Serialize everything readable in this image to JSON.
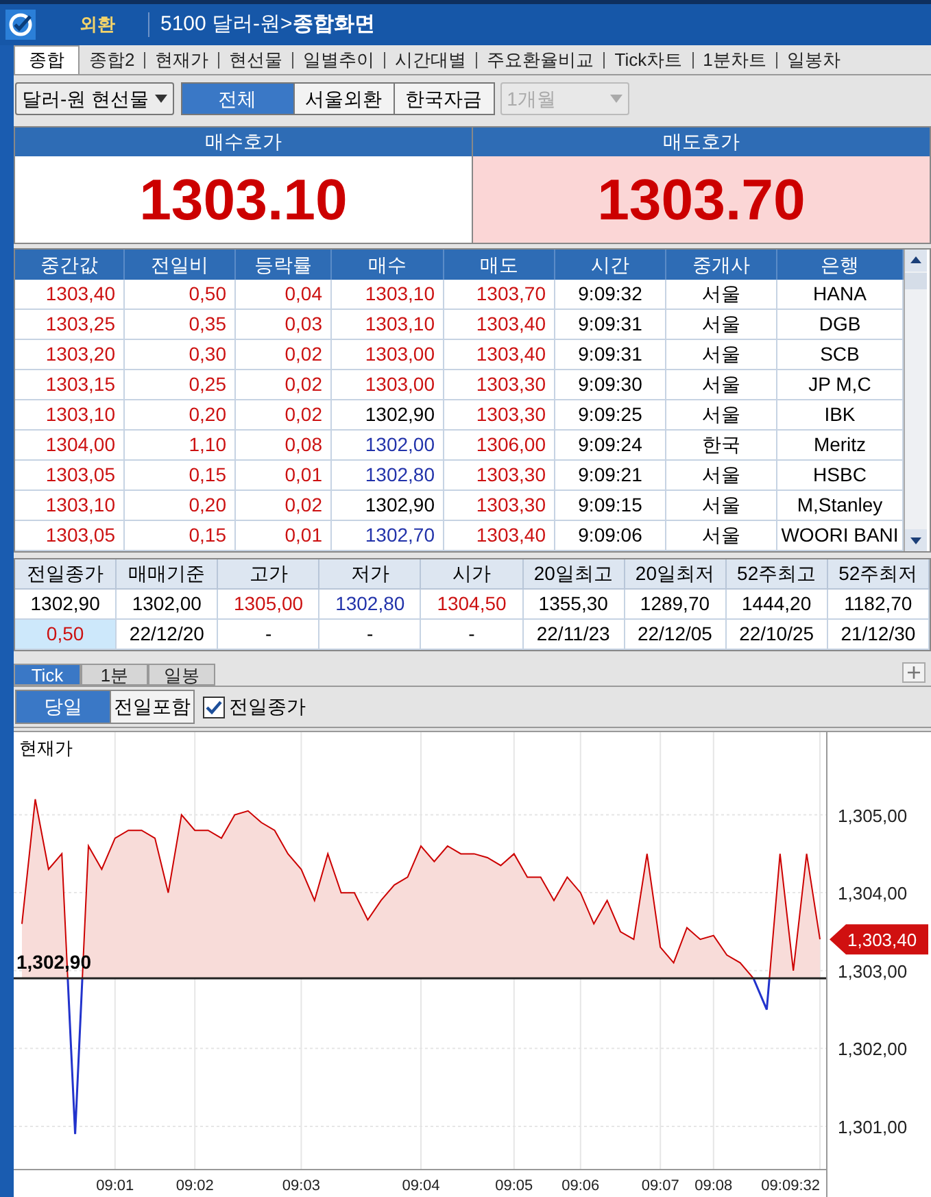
{
  "title_bar": {
    "badge": "외환",
    "title": "5100 달러-원>**종합화면**"
  },
  "tabs": [
    {
      "label": "종합",
      "selected": true
    },
    {
      "label": "종합2",
      "selected": false
    },
    {
      "label": "현재가",
      "selected": false
    },
    {
      "label": "현선물",
      "selected": false
    },
    {
      "label": "일별추이",
      "selected": false
    },
    {
      "label": "시간대별",
      "selected": false
    },
    {
      "label": "주요환율비교",
      "selected": false
    },
    {
      "label": "Tick차트",
      "selected": false
    },
    {
      "label": "1분차트",
      "selected": false
    },
    {
      "label": "일봉차",
      "selected": false
    }
  ],
  "toolbar": {
    "market": {
      "value": "달러-원 현선물"
    },
    "filters": [
      {
        "label": "전체",
        "selected": true
      },
      {
        "label": "서울외환",
        "selected": false
      },
      {
        "label": "한국자금",
        "selected": false
      }
    ],
    "period": {
      "value": "1개월",
      "disabled": true
    }
  },
  "quotes": [
    {
      "kind": "bid",
      "label": "매수호가",
      "price": "1303.10"
    },
    {
      "kind": "ask",
      "label": "매도호가",
      "price": "1303.70"
    }
  ],
  "trades": {
    "columns": [
      "중간값",
      "전일비",
      "등락률",
      "매수",
      "매도",
      "시간",
      "중개사",
      "은행"
    ],
    "rows": [
      [
        {
          "text": "1303,40",
          "color": "#cc1111"
        },
        {
          "text": "0,50",
          "color": "#cc1111"
        },
        {
          "text": "0,04",
          "color": "#cc1111"
        },
        {
          "text": "1303,10",
          "color": "#cc1111"
        },
        {
          "text": "1303,70",
          "color": "#cc1111"
        },
        {
          "text": "9:09:32",
          "color": "#000000"
        },
        {
          "text": "서울",
          "color": "#000000"
        },
        {
          "text": "HANA",
          "color": "#000000"
        }
      ],
      [
        {
          "text": "1303,25",
          "color": "#cc1111"
        },
        {
          "text": "0,35",
          "color": "#cc1111"
        },
        {
          "text": "0,03",
          "color": "#cc1111"
        },
        {
          "text": "1303,10",
          "color": "#cc1111"
        },
        {
          "text": "1303,40",
          "color": "#cc1111"
        },
        {
          "text": "9:09:31",
          "color": "#000000"
        },
        {
          "text": "서울",
          "color": "#000000"
        },
        {
          "text": "DGB",
          "color": "#000000"
        }
      ],
      [
        {
          "text": "1303,20",
          "color": "#cc1111"
        },
        {
          "text": "0,30",
          "color": "#cc1111"
        },
        {
          "text": "0,02",
          "color": "#cc1111"
        },
        {
          "text": "1303,00",
          "color": "#cc1111"
        },
        {
          "text": "1303,40",
          "color": "#cc1111"
        },
        {
          "text": "9:09:31",
          "color": "#000000"
        },
        {
          "text": "서울",
          "color": "#000000"
        },
        {
          "text": "SCB",
          "color": "#000000"
        }
      ],
      [
        {
          "text": "1303,15",
          "color": "#cc1111"
        },
        {
          "text": "0,25",
          "color": "#cc1111"
        },
        {
          "text": "0,02",
          "color": "#cc1111"
        },
        {
          "text": "1303,00",
          "color": "#cc1111"
        },
        {
          "text": "1303,30",
          "color": "#cc1111"
        },
        {
          "text": "9:09:30",
          "color": "#000000"
        },
        {
          "text": "서울",
          "color": "#000000"
        },
        {
          "text": "JP M,C",
          "color": "#000000"
        }
      ],
      [
        {
          "text": "1303,10",
          "color": "#cc1111"
        },
        {
          "text": "0,20",
          "color": "#cc1111"
        },
        {
          "text": "0,02",
          "color": "#cc1111"
        },
        {
          "text": "1302,90",
          "color": "#000000"
        },
        {
          "text": "1303,30",
          "color": "#cc1111"
        },
        {
          "text": "9:09:25",
          "color": "#000000"
        },
        {
          "text": "서울",
          "color": "#000000"
        },
        {
          "text": "IBK",
          "color": "#000000"
        }
      ],
      [
        {
          "text": "1304,00",
          "color": "#cc1111"
        },
        {
          "text": "1,10",
          "color": "#cc1111"
        },
        {
          "text": "0,08",
          "color": "#cc1111"
        },
        {
          "text": "1302,00",
          "color": "#2233aa"
        },
        {
          "text": "1306,00",
          "color": "#cc1111"
        },
        {
          "text": "9:09:24",
          "color": "#000000"
        },
        {
          "text": "한국",
          "color": "#000000"
        },
        {
          "text": "Meritz",
          "color": "#000000"
        }
      ],
      [
        {
          "text": "1303,05",
          "color": "#cc1111"
        },
        {
          "text": "0,15",
          "color": "#cc1111"
        },
        {
          "text": "0,01",
          "color": "#cc1111"
        },
        {
          "text": "1302,80",
          "color": "#2233aa"
        },
        {
          "text": "1303,30",
          "color": "#cc1111"
        },
        {
          "text": "9:09:21",
          "color": "#000000"
        },
        {
          "text": "서울",
          "color": "#000000"
        },
        {
          "text": "HSBC",
          "color": "#000000"
        }
      ],
      [
        {
          "text": "1303,10",
          "color": "#cc1111"
        },
        {
          "text": "0,20",
          "color": "#cc1111"
        },
        {
          "text": "0,02",
          "color": "#cc1111"
        },
        {
          "text": "1302,90",
          "color": "#000000"
        },
        {
          "text": "1303,30",
          "color": "#cc1111"
        },
        {
          "text": "9:09:15",
          "color": "#000000"
        },
        {
          "text": "서울",
          "color": "#000000"
        },
        {
          "text": "M,Stanley",
          "color": "#000000"
        }
      ],
      [
        {
          "text": "1303,05",
          "color": "#cc1111"
        },
        {
          "text": "0,15",
          "color": "#cc1111"
        },
        {
          "text": "0,01",
          "color": "#cc1111"
        },
        {
          "text": "1302,70",
          "color": "#2233aa"
        },
        {
          "text": "1303,40",
          "color": "#cc1111"
        },
        {
          "text": "9:09:06",
          "color": "#000000"
        },
        {
          "text": "서울",
          "color": "#000000"
        },
        {
          "text": "WOORI BANI",
          "color": "#000000"
        }
      ]
    ]
  },
  "summary": {
    "columns": [
      "전일종가",
      "매매기준",
      "고가",
      "저가",
      "시가",
      "20일최고",
      "20일최저",
      "52주최고",
      "52주최저"
    ],
    "rows": [
      [
        {
          "text": "1302,90",
          "color": "#000000",
          "highlighted": false
        },
        {
          "text": "1302,00",
          "color": "#000000",
          "highlighted": false
        },
        {
          "text": "1305,00",
          "color": "#cc1111",
          "highlighted": false
        },
        {
          "text": "1302,80",
          "color": "#2233aa",
          "highlighted": false
        },
        {
          "text": "1304,50",
          "color": "#cc1111",
          "highlighted": false
        },
        {
          "text": "1355,30",
          "color": "#000000",
          "highlighted": false
        },
        {
          "text": "1289,70",
          "color": "#000000",
          "highlighted": false
        },
        {
          "text": "1444,20",
          "color": "#000000",
          "highlighted": false
        },
        {
          "text": "1182,70",
          "color": "#000000",
          "highlighted": false
        }
      ],
      [
        {
          "text": "0,50",
          "color": "#cc1111",
          "highlighted": true
        },
        {
          "text": "22/12/20",
          "color": "#000000",
          "highlighted": false
        },
        {
          "text": "-",
          "color": "#000000",
          "highlighted": false
        },
        {
          "text": "-",
          "color": "#000000",
          "highlighted": false
        },
        {
          "text": "-",
          "color": "#000000",
          "highlighted": false
        },
        {
          "text": "22/11/23",
          "color": "#000000",
          "highlighted": false
        },
        {
          "text": "22/12/05",
          "color": "#000000",
          "highlighted": false
        },
        {
          "text": "22/10/25",
          "color": "#000000",
          "highlighted": false
        },
        {
          "text": "21/12/30",
          "color": "#000000",
          "highlighted": false
        }
      ]
    ]
  },
  "chart_tabs": [
    {
      "label": "Tick",
      "selected": true
    },
    {
      "label": "1분",
      "selected": false
    },
    {
      "label": "일봉",
      "selected": false
    }
  ],
  "range_buttons": [
    {
      "label": "당일",
      "selected": true
    },
    {
      "label": "전일포함",
      "selected": false
    }
  ],
  "prev_close_checkbox": {
    "label": "전일종가",
    "checked": true
  },
  "chart": {
    "baseline_label": "1,302,90",
    "current_label": "1,303,40",
    "title": "현재가",
    "y_axis_labels": [
      "1,305,00",
      "1,304,00",
      "1,303,00",
      "1,302,00",
      "1,301,00"
    ],
    "x_axis_labels": [
      "09:01",
      "09:02",
      "09:03",
      "09:04",
      "09:05",
      "09:06",
      "09:07",
      "09:08",
      "09:09:32"
    ]
  }
}
